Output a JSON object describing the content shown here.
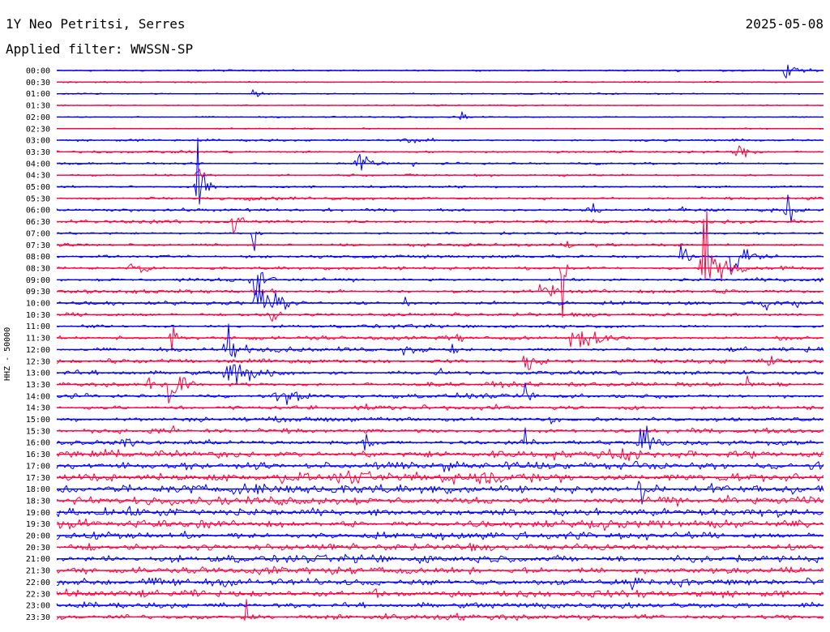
{
  "header": {
    "station": "1Y Neo Petritsi, Serres",
    "date": "2025-05-08",
    "filter": "Applied filter: WWSSN-SP"
  },
  "chart_data": {
    "type": "line",
    "title": "1Y Neo Petritsi, Serres",
    "ylabel": "HHZ - 50000",
    "row_colors": [
      "#0000ff",
      "#ff0040"
    ],
    "rows": [
      {
        "time": "00:00",
        "noise": 0.7,
        "events": [
          {
            "t": 0.95,
            "amp": 18,
            "dur": 0.012
          }
        ]
      },
      {
        "time": "00:30",
        "noise": 0.6,
        "events": []
      },
      {
        "time": "01:00",
        "noise": 0.6,
        "events": [
          {
            "t": 0.255,
            "amp": 7,
            "dur": 0.01
          }
        ]
      },
      {
        "time": "01:30",
        "noise": 0.6,
        "events": [
          {
            "t": 0.5,
            "amp": 3,
            "dur": 0.004
          }
        ]
      },
      {
        "time": "02:00",
        "noise": 0.6,
        "events": [
          {
            "t": 0.528,
            "amp": 9,
            "dur": 0.004
          }
        ]
      },
      {
        "time": "02:30",
        "noise": 0.5,
        "events": []
      },
      {
        "time": "03:00",
        "noise": 1.0,
        "events": [
          {
            "t": 0.45,
            "amp": 3,
            "dur": 0.06
          }
        ]
      },
      {
        "time": "03:30",
        "noise": 1.0,
        "events": [
          {
            "t": 0.885,
            "amp": 13,
            "dur": 0.012
          }
        ]
      },
      {
        "time": "04:00",
        "noise": 0.9,
        "events": [
          {
            "t": 0.39,
            "amp": 14,
            "dur": 0.02
          },
          {
            "t": 0.465,
            "amp": 4,
            "dur": 0.004
          }
        ]
      },
      {
        "time": "04:30",
        "noise": 1.0,
        "events": [
          {
            "t": 0.183,
            "amp": 14,
            "dur": 0.006
          }
        ]
      },
      {
        "time": "05:00",
        "noise": 1.0,
        "events": [
          {
            "t": 0.183,
            "amp": 40,
            "dur": 0.01
          }
        ]
      },
      {
        "time": "05:30",
        "noise": 1.3,
        "events": [
          {
            "t": 0.254,
            "amp": 12,
            "dur": 0.004
          }
        ]
      },
      {
        "time": "06:00",
        "noise": 1.3,
        "events": [
          {
            "t": 0.69,
            "amp": 18,
            "dur": 0.01
          },
          {
            "t": 0.952,
            "amp": 20,
            "dur": 0.008
          },
          {
            "t": 0.815,
            "amp": 12,
            "dur": 0.005
          }
        ]
      },
      {
        "time": "06:30",
        "noise": 1.5,
        "events": [
          {
            "t": 0.228,
            "amp": 16,
            "dur": 0.012
          }
        ]
      },
      {
        "time": "07:00",
        "noise": 1.0,
        "events": [
          {
            "t": 0.255,
            "amp": 30,
            "dur": 0.004
          }
        ]
      },
      {
        "time": "07:30",
        "noise": 1.3,
        "events": [
          {
            "t": 0.665,
            "amp": 8,
            "dur": 0.004
          }
        ]
      },
      {
        "time": "08:00",
        "noise": 1.5,
        "events": [
          {
            "t": 0.815,
            "amp": 38,
            "dur": 0.006
          },
          {
            "t": 0.88,
            "amp": 20,
            "dur": 0.02
          },
          {
            "t": 0.595,
            "amp": 6,
            "dur": 0.008
          }
        ]
      },
      {
        "time": "08:30",
        "noise": 1.5,
        "events": [
          {
            "t": 0.097,
            "amp": 16,
            "dur": 0.012
          },
          {
            "t": 0.84,
            "amp": 40,
            "dur": 0.02
          },
          {
            "t": 0.66,
            "amp": 100,
            "dur": 0.004
          },
          {
            "t": 0.845,
            "amp": 190,
            "dur": 0.004
          }
        ]
      },
      {
        "time": "09:00",
        "noise": 1.4,
        "events": [
          {
            "t": 0.255,
            "amp": 45,
            "dur": 0.012
          }
        ]
      },
      {
        "time": "09:30",
        "noise": 1.6,
        "events": [
          {
            "t": 0.63,
            "amp": 14,
            "dur": 0.01
          },
          {
            "t": 0.645,
            "amp": 10,
            "dur": 0.006
          }
        ]
      },
      {
        "time": "10:00",
        "noise": 1.6,
        "events": [
          {
            "t": 0.26,
            "amp": 35,
            "dur": 0.02
          },
          {
            "t": 0.455,
            "amp": 8,
            "dur": 0.01
          },
          {
            "t": 0.918,
            "amp": 20,
            "dur": 0.01
          },
          {
            "t": 0.955,
            "amp": 10,
            "dur": 0.005
          },
          {
            "t": 0.965,
            "amp": 10,
            "dur": 0.005
          }
        ]
      },
      {
        "time": "10:30",
        "noise": 1.6,
        "events": [
          {
            "t": 0.28,
            "amp": 14,
            "dur": 0.006
          }
        ]
      },
      {
        "time": "11:00",
        "noise": 1.5,
        "events": [
          {
            "t": 0.44,
            "amp": 5,
            "dur": 0.004
          }
        ]
      },
      {
        "time": "11:30",
        "noise": 1.8,
        "events": [
          {
            "t": 0.665,
            "amp": 28,
            "dur": 0.03
          },
          {
            "t": 0.52,
            "amp": 10,
            "dur": 0.008
          },
          {
            "t": 0.15,
            "amp": 30,
            "dur": 0.004
          }
        ]
      },
      {
        "time": "12:00",
        "noise": 1.8,
        "events": [
          {
            "t": 0.22,
            "amp": 40,
            "dur": 0.012
          },
          {
            "t": 0.45,
            "amp": 8,
            "dur": 0.02
          },
          {
            "t": 0.515,
            "amp": 14,
            "dur": 0.006
          }
        ]
      },
      {
        "time": "12:30",
        "noise": 1.8,
        "events": [
          {
            "t": 0.61,
            "amp": 16,
            "dur": 0.015
          },
          {
            "t": 0.927,
            "amp": 12,
            "dur": 0.008
          },
          {
            "t": 0.15,
            "amp": 20,
            "dur": 0.006
          }
        ]
      },
      {
        "time": "13:00",
        "noise": 1.8,
        "events": [
          {
            "t": 0.22,
            "amp": 25,
            "dur": 0.03
          },
          {
            "t": 0.495,
            "amp": 10,
            "dur": 0.008
          }
        ]
      },
      {
        "time": "13:30",
        "noise": 2.0,
        "events": [
          {
            "t": 0.145,
            "amp": 30,
            "dur": 0.015
          },
          {
            "t": 0.12,
            "amp": 15,
            "dur": 0.006
          },
          {
            "t": 0.9,
            "amp": 16,
            "dur": 0.004
          },
          {
            "t": 0.942,
            "amp": 8,
            "dur": 0.006
          }
        ]
      },
      {
        "time": "14:00",
        "noise": 2.0,
        "events": [
          {
            "t": 0.285,
            "amp": 20,
            "dur": 0.02
          },
          {
            "t": 0.61,
            "amp": 14,
            "dur": 0.008
          }
        ]
      },
      {
        "time": "14:30",
        "noise": 2.0,
        "events": []
      },
      {
        "time": "15:00",
        "noise": 2.0,
        "events": [
          {
            "t": 0.645,
            "amp": 14,
            "dur": 0.005
          }
        ]
      },
      {
        "time": "15:30",
        "noise": 2.0,
        "events": [
          {
            "t": 0.15,
            "amp": 10,
            "dur": 0.004
          }
        ]
      },
      {
        "time": "16:00",
        "noise": 2.2,
        "events": [
          {
            "t": 0.09,
            "amp": 12,
            "dur": 0.01
          },
          {
            "t": 0.4,
            "amp": 14,
            "dur": 0.008
          },
          {
            "t": 0.61,
            "amp": 20,
            "dur": 0.008
          },
          {
            "t": 0.76,
            "amp": 35,
            "dur": 0.015
          }
        ]
      },
      {
        "time": "16:30",
        "noise": 3.5,
        "events": [
          {
            "t": 0.73,
            "amp": 8,
            "dur": 0.03
          }
        ]
      },
      {
        "time": "17:00",
        "noise": 3.5,
        "events": [
          {
            "t": 0.985,
            "amp": 10,
            "dur": 0.008
          }
        ]
      },
      {
        "time": "17:30",
        "noise": 4.5,
        "events": [
          {
            "t": 0.5,
            "amp": 6,
            "dur": 0.08
          }
        ]
      },
      {
        "time": "18:00",
        "noise": 4.5,
        "events": [
          {
            "t": 0.76,
            "amp": 40,
            "dur": 0.004
          }
        ]
      },
      {
        "time": "18:30",
        "noise": 3.5,
        "events": []
      },
      {
        "time": "19:00",
        "noise": 3.5,
        "events": []
      },
      {
        "time": "19:30",
        "noise": 3.5,
        "events": []
      },
      {
        "time": "20:00",
        "noise": 3.5,
        "events": []
      },
      {
        "time": "20:30",
        "noise": 3.2,
        "events": []
      },
      {
        "time": "21:00",
        "noise": 3.5,
        "events": [
          {
            "t": 0.81,
            "amp": 6,
            "dur": 0.02
          }
        ]
      },
      {
        "time": "21:30",
        "noise": 3.2,
        "events": []
      },
      {
        "time": "22:00",
        "noise": 3.2,
        "events": [
          {
            "t": 0.75,
            "amp": 18,
            "dur": 0.008
          }
        ]
      },
      {
        "time": "22:30",
        "noise": 3.0,
        "events": [
          {
            "t": 0.41,
            "amp": 20,
            "dur": 0.01
          }
        ]
      },
      {
        "time": "23:00",
        "noise": 2.8,
        "events": []
      },
      {
        "time": "23:30",
        "noise": 2.6,
        "events": [
          {
            "t": 0.247,
            "amp": 14,
            "dur": 0.008
          }
        ]
      }
    ]
  }
}
